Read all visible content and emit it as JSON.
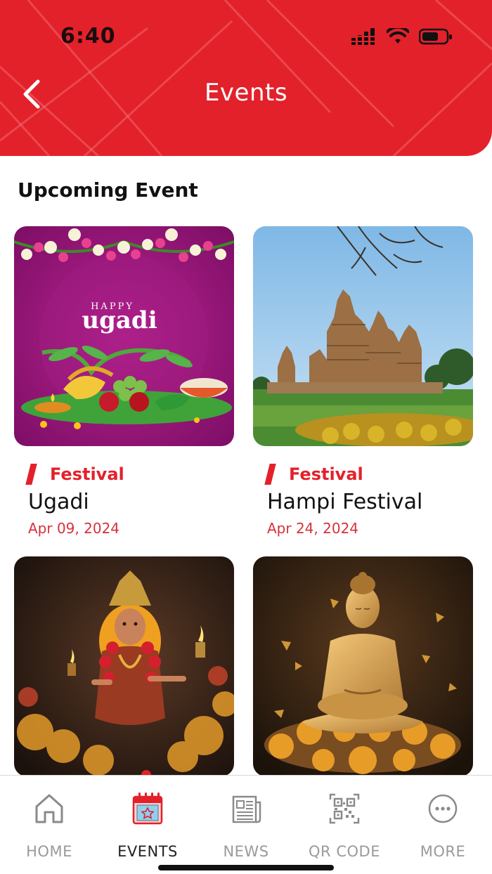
{
  "status_bar": {
    "time": "6:40"
  },
  "header": {
    "title": "Events"
  },
  "section": {
    "title": "Upcoming Event"
  },
  "events": [
    {
      "category": "Festival",
      "title": "Ugadi",
      "date": "Apr 09, 2024",
      "image": "happy-ugadi-poster",
      "image_text_small": "HAPPY",
      "image_text_large": "ugadi"
    },
    {
      "category": "Festival",
      "title": "Hampi Festival",
      "date": "Apr 24, 2024",
      "image": "temple-photo"
    },
    {
      "image": "goddess-idol-photo"
    },
    {
      "image": "buddha-statue-photo"
    }
  ],
  "tabbar": {
    "items": [
      {
        "label": "HOME",
        "icon": "home-icon"
      },
      {
        "label": "EVENTS",
        "icon": "calendar-icon",
        "active": true
      },
      {
        "label": "NEWS",
        "icon": "newspaper-icon"
      },
      {
        "label": "QR CODE",
        "icon": "qr-code-icon"
      },
      {
        "label": "MORE",
        "icon": "more-icon"
      }
    ]
  },
  "colors": {
    "brand_red": "#e3212b",
    "date_red": "#d6323a",
    "inactive_gray": "#9a9a9a"
  }
}
